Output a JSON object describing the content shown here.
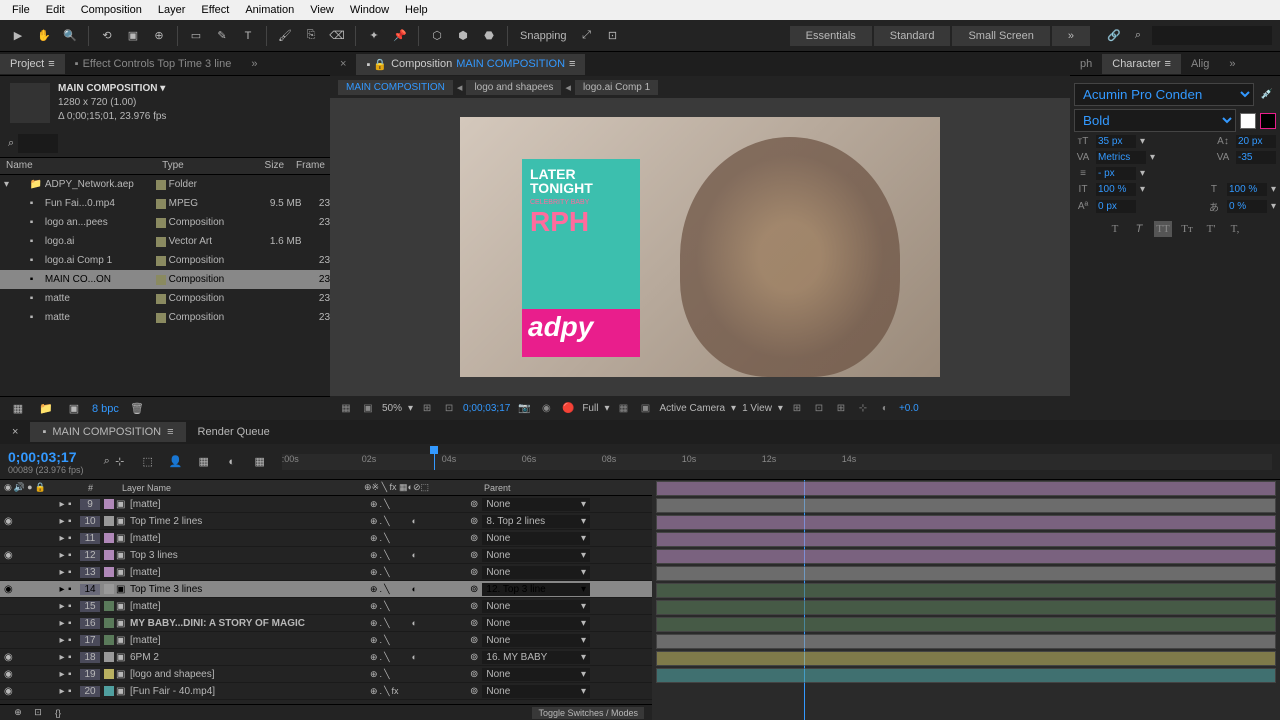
{
  "menu": [
    "File",
    "Edit",
    "Composition",
    "Layer",
    "Effect",
    "Animation",
    "View",
    "Window",
    "Help"
  ],
  "snapping": "Snapping",
  "workspaces": [
    "Essentials",
    "Standard",
    "Small Screen"
  ],
  "leftPanel": {
    "projectTab": "Project",
    "effectTab": "Effect Controls Top Time 3 line",
    "compName": "MAIN COMPOSITION",
    "compDims": "1280 x 720 (1.00)",
    "compDuration": "Δ 0;00;15;01, 23.976 fps",
    "headers": {
      "name": "Name",
      "type": "Type",
      "size": "Size",
      "frame": "Frame"
    },
    "items": [
      {
        "name": "ADPY_Network.aep",
        "type": "Folder",
        "size": "",
        "frame": "",
        "folder": true
      },
      {
        "name": "Fun Fai...0.mp4",
        "type": "MPEG",
        "size": "9.5 MB",
        "frame": "23"
      },
      {
        "name": "logo an...pees",
        "type": "Composition",
        "size": "",
        "frame": "23"
      },
      {
        "name": "logo.ai",
        "type": "Vector Art",
        "size": "1.6 MB",
        "frame": ""
      },
      {
        "name": "logo.ai Comp 1",
        "type": "Composition",
        "size": "",
        "frame": "23"
      },
      {
        "name": "MAIN CO...ON",
        "type": "Composition",
        "size": "",
        "frame": "23",
        "selected": true
      },
      {
        "name": "matte",
        "type": "Composition",
        "size": "",
        "frame": "23"
      },
      {
        "name": "matte",
        "type": "Composition",
        "size": "",
        "frame": "23"
      }
    ],
    "bpc": "8 bpc"
  },
  "compPanel": {
    "tabLabel": "Composition",
    "tabName": "MAIN COMPOSITION",
    "breadcrumb": [
      "MAIN COMPOSITION",
      "logo and shapees",
      "logo.ai Comp 1"
    ],
    "overlay": {
      "title1": "LATER",
      "title2": "TONIGHT",
      "sub": "CELEBRITY BABY",
      "bottom": "adpy"
    },
    "footer": {
      "zoom": "50%",
      "time": "0;00;03;17",
      "res": "Full",
      "camera": "Active Camera",
      "view": "1 View",
      "exposure": "+0.0"
    }
  },
  "charPanel": {
    "tab": "Character",
    "alignTab": "Alig",
    "phTab": "ph",
    "font": "Acumin Pro Conden",
    "weight": "Bold",
    "size": "35 px",
    "leading": "20 px",
    "kerning": "Metrics",
    "tracking": "-35",
    "stroke": "- px",
    "vscale": "100 %",
    "hscale": "100 %",
    "baseline": "0 px",
    "tsume": "0 %"
  },
  "timeline": {
    "tab": "MAIN COMPOSITION",
    "renderTab": "Render Queue",
    "time": "0;00;03;17",
    "frames": "00089 (23.976 fps)",
    "colHeaders": {
      "num": "#",
      "layerName": "Layer Name",
      "parent": "Parent"
    },
    "ruler": [
      ":00s",
      "02s",
      "04s",
      "06s",
      "08s",
      "10s",
      "12s",
      "14s"
    ],
    "layers": [
      {
        "num": "9",
        "name": "[matte]",
        "parent": "None",
        "color": "#b088b8"
      },
      {
        "num": "10",
        "name": "Top Time 2 lines",
        "parent": "8. Top 2 lines",
        "color": "#999",
        "eye": true,
        "mb": true
      },
      {
        "num": "11",
        "name": "[matte]",
        "parent": "None",
        "color": "#b088b8"
      },
      {
        "num": "12",
        "name": "Top 3 lines",
        "parent": "None",
        "color": "#b088b8",
        "eye": true,
        "mb": true
      },
      {
        "num": "13",
        "name": "[matte]",
        "parent": "None",
        "color": "#b088b8"
      },
      {
        "num": "14",
        "name": "Top Time 3 lines",
        "parent": "12. Top 3 line",
        "color": "#999",
        "eye": true,
        "mb": true,
        "selected": true
      },
      {
        "num": "15",
        "name": "[matte]",
        "parent": "None",
        "color": "#5a7a5a"
      },
      {
        "num": "16",
        "name": "MY BABY...DINI: A STORY OF MAGIC",
        "parent": "None",
        "color": "#5a7a5a",
        "mb": true,
        "bold": true
      },
      {
        "num": "17",
        "name": "[matte]",
        "parent": "None",
        "color": "#5a7a5a"
      },
      {
        "num": "18",
        "name": "6PM 2",
        "parent": "16. MY BABY",
        "color": "#999",
        "eye": true,
        "mb": true
      },
      {
        "num": "19",
        "name": "[logo and shapees]",
        "parent": "None",
        "color": "#b8b060",
        "eye": true
      },
      {
        "num": "20",
        "name": "[Fun Fair - 40.mp4]",
        "parent": "None",
        "color": "#50a0a0",
        "eye": true,
        "fx": true
      }
    ],
    "toggleLabel": "Toggle Switches / Modes"
  }
}
